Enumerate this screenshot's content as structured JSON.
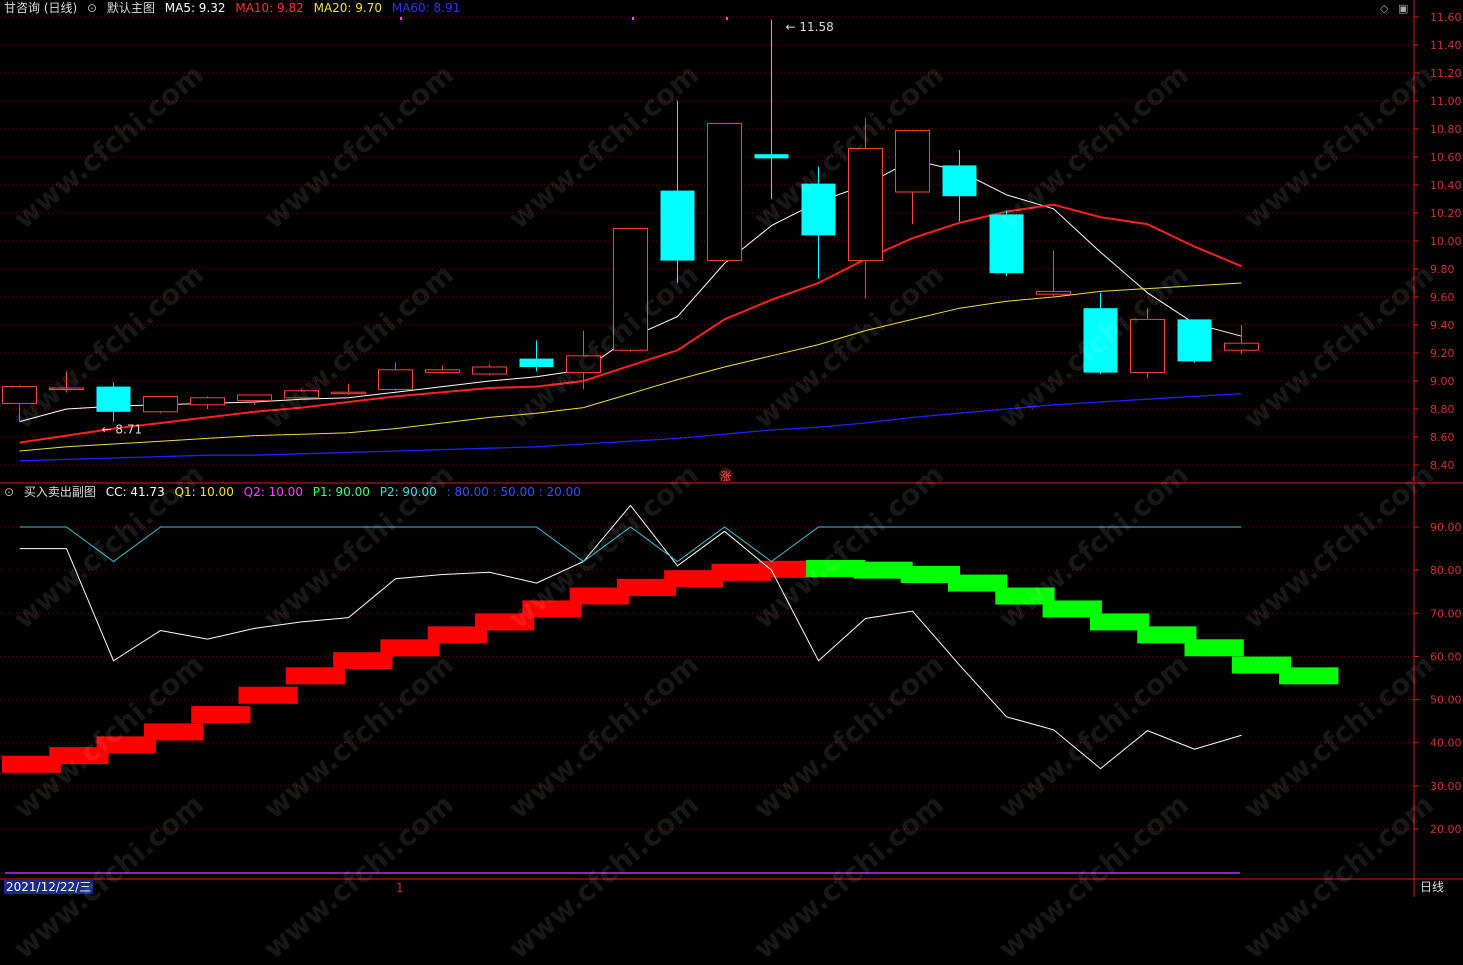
{
  "main_header": {
    "stock": "甘咨询 (日线)",
    "indicator": "默认主图",
    "ma5": "MA5: 9.32",
    "ma10": "MA10: 9.82",
    "ma20": "MA20: 9.70",
    "ma60": "MA60: 8.91"
  },
  "sub_header": {
    "indicator": "买入卖出副图",
    "cc": "CC: 41.73",
    "q1": "Q1: 10.00",
    "q2": "Q2: 10.00",
    "p1": "P1: 90.00",
    "p2": "P2: 90.00",
    "levels": ": 80.00 : 50.00 : 20.00"
  },
  "footer": {
    "date": "2021/12/22/三",
    "period": "日线",
    "month_mark": "1"
  },
  "watermark": "www.cfchi.com",
  "colors": {
    "up": "#ff4040",
    "down": "#00ffff",
    "ma5": "#ffffff",
    "ma10": "#ff2020",
    "ma20": "#e8e040",
    "ma60": "#2020ff",
    "grid": "#8b0000",
    "axis": "#d02020",
    "bull_bar": "#ff0000",
    "bear_bar": "#00ff00",
    "cc_line": "#ffffff",
    "p_line": "#40c0d0"
  },
  "chart_data": [
    {
      "type": "candlestick",
      "ylim": [
        8.3,
        11.7
      ],
      "y_ticks": [
        "11.60",
        "11.40",
        "11.20",
        "11.00",
        "10.80",
        "10.60",
        "10.40",
        "10.20",
        "10.00",
        "9.80",
        "9.60",
        "9.40",
        "9.20",
        "9.00",
        "8.80",
        "8.60",
        "8.40"
      ],
      "annotations": [
        "11.58",
        "8.71"
      ],
      "marker_label": "涨",
      "candles": [
        {
          "o": 8.84,
          "c": 8.96,
          "h": 8.97,
          "l": 8.71
        },
        {
          "o": 8.95,
          "c": 8.95,
          "h": 9.07,
          "l": 8.92
        },
        {
          "o": 8.96,
          "c": 8.78,
          "h": 8.99,
          "l": 8.71
        },
        {
          "o": 8.78,
          "c": 8.89,
          "h": 8.89,
          "l": 8.77
        },
        {
          "o": 8.83,
          "c": 8.88,
          "h": 8.89,
          "l": 8.8
        },
        {
          "o": 8.86,
          "c": 8.9,
          "h": 8.9,
          "l": 8.83
        },
        {
          "o": 8.88,
          "c": 8.93,
          "h": 8.94,
          "l": 8.87
        },
        {
          "o": 8.92,
          "c": 8.92,
          "h": 8.98,
          "l": 8.9
        },
        {
          "o": 8.94,
          "c": 9.08,
          "h": 9.13,
          "l": 8.93
        },
        {
          "o": 9.06,
          "c": 9.08,
          "h": 9.11,
          "l": 9.05
        },
        {
          "o": 9.05,
          "c": 9.1,
          "h": 9.12,
          "l": 9.04
        },
        {
          "o": 9.16,
          "c": 9.1,
          "h": 9.29,
          "l": 9.07
        },
        {
          "o": 9.06,
          "c": 9.18,
          "h": 9.36,
          "l": 8.94
        },
        {
          "o": 9.22,
          "c": 10.09,
          "h": 10.09,
          "l": 9.21
        },
        {
          "o": 10.36,
          "c": 9.86,
          "h": 11.0,
          "l": 9.7
        },
        {
          "o": 9.86,
          "c": 10.84,
          "h": 10.84,
          "l": 9.86
        },
        {
          "o": 10.62,
          "c": 10.59,
          "h": 11.58,
          "l": 10.3
        },
        {
          "o": 10.41,
          "c": 10.04,
          "h": 10.53,
          "l": 9.73
        },
        {
          "o": 9.86,
          "c": 10.66,
          "h": 10.88,
          "l": 9.59
        },
        {
          "o": 10.35,
          "c": 10.79,
          "h": 10.79,
          "l": 10.12
        },
        {
          "o": 10.54,
          "c": 10.32,
          "h": 10.65,
          "l": 10.14
        },
        {
          "o": 10.19,
          "c": 9.77,
          "h": 10.22,
          "l": 9.75
        },
        {
          "o": 9.62,
          "c": 9.64,
          "h": 9.93,
          "l": 9.6
        },
        {
          "o": 9.52,
          "c": 9.06,
          "h": 9.63,
          "l": 9.05
        },
        {
          "o": 9.06,
          "c": 9.44,
          "h": 9.52,
          "l": 9.02
        },
        {
          "o": 9.44,
          "c": 9.14,
          "h": 9.44,
          "l": 9.13
        },
        {
          "o": 9.22,
          "c": 9.27,
          "h": 9.4,
          "l": 9.19
        }
      ],
      "series": [
        {
          "name": "MA5",
          "values": [
            8.71,
            8.8,
            8.82,
            8.83,
            8.84,
            8.85,
            8.87,
            8.88,
            8.92,
            8.96,
            9.0,
            9.03,
            9.08,
            9.31,
            9.46,
            9.84,
            10.11,
            10.28,
            10.4,
            10.58,
            10.5,
            10.33,
            10.23,
            9.92,
            9.63,
            9.41,
            9.32
          ]
        },
        {
          "name": "MA10",
          "values": [
            8.56,
            8.61,
            8.66,
            8.7,
            8.74,
            8.78,
            8.81,
            8.85,
            8.89,
            8.92,
            8.95,
            8.96,
            9.0,
            9.11,
            9.22,
            9.44,
            9.58,
            9.7,
            9.87,
            10.02,
            10.13,
            10.21,
            10.26,
            10.17,
            10.12,
            9.96,
            9.82
          ]
        },
        {
          "name": "MA20",
          "values": [
            8.5,
            8.53,
            8.55,
            8.57,
            8.59,
            8.61,
            8.62,
            8.63,
            8.66,
            8.7,
            8.74,
            8.77,
            8.81,
            8.91,
            9.01,
            9.1,
            9.18,
            9.26,
            9.36,
            9.44,
            9.52,
            9.57,
            9.6,
            9.64,
            9.66,
            9.68,
            9.7
          ]
        },
        {
          "name": "MA60",
          "values": [
            8.43,
            8.44,
            8.45,
            8.46,
            8.47,
            8.47,
            8.48,
            8.49,
            8.5,
            8.51,
            8.52,
            8.53,
            8.55,
            8.57,
            8.59,
            8.62,
            8.65,
            8.67,
            8.7,
            8.74,
            8.77,
            8.8,
            8.83,
            8.85,
            8.87,
            8.89,
            8.91
          ]
        }
      ]
    },
    {
      "type": "bar",
      "ylim": [
        8,
        100
      ],
      "y_ticks": [
        "90.00",
        "80.00",
        "70.00",
        "60.00",
        "50.00",
        "40.00",
        "30.00",
        "20.00"
      ],
      "steps": [
        35,
        37,
        39.5,
        42.5,
        46.5,
        51,
        55.5,
        59,
        62,
        65,
        68,
        71,
        74,
        76,
        78,
        79.5,
        80.2,
        80.4,
        80,
        79,
        77,
        74,
        71,
        68,
        65,
        62,
        58,
        55.5
      ],
      "step_colors": [
        "up",
        "up",
        "up",
        "up",
        "up",
        "up",
        "up",
        "up",
        "up",
        "up",
        "up",
        "up",
        "up",
        "up",
        "up",
        "up",
        "up",
        "down",
        "down",
        "down",
        "down",
        "down",
        "down",
        "down",
        "down",
        "down",
        "down",
        "down"
      ],
      "series": [
        {
          "name": "CC",
          "values": [
            85,
            85,
            59,
            66,
            64,
            66.5,
            68,
            69,
            78,
            79,
            79.5,
            77,
            82,
            95,
            81,
            89,
            80,
            59,
            68.8,
            70.5,
            58,
            46,
            43,
            34,
            42.8,
            38.5,
            41.73
          ]
        },
        {
          "name": "P1",
          "values": [
            90,
            90,
            82,
            90,
            90,
            90,
            90,
            90,
            90,
            90,
            90,
            90,
            82,
            90,
            82,
            90,
            82,
            90,
            90,
            90,
            90,
            90,
            90,
            90,
            90,
            90,
            90
          ]
        }
      ]
    }
  ]
}
